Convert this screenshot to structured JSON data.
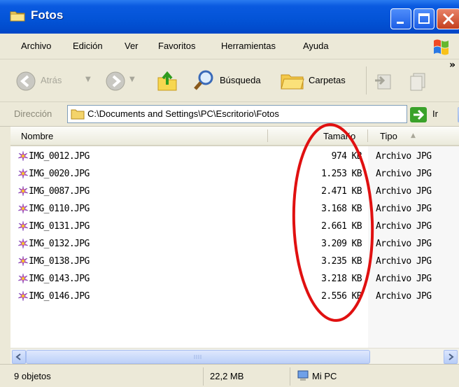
{
  "window": {
    "title": "Fotos"
  },
  "menu": {
    "items": [
      "Archivo",
      "Edición",
      "Ver",
      "Favoritos",
      "Herramientas",
      "Ayuda"
    ]
  },
  "toolbar": {
    "back_label": "Atrás",
    "search_label": "Búsqueda",
    "folders_label": "Carpetas",
    "overflow": "»"
  },
  "address": {
    "label": "Dirección",
    "path": "C:\\Documents and Settings\\PC\\Escritorio\\Fotos",
    "go_label": "Ir"
  },
  "columns": {
    "name": "Nombre",
    "size": "Tamaño",
    "type": "Tipo"
  },
  "files": [
    {
      "name": "IMG_0012.JPG",
      "size": "974 KB",
      "type": "Archivo JPG"
    },
    {
      "name": "IMG_0020.JPG",
      "size": "1.253 KB",
      "type": "Archivo JPG"
    },
    {
      "name": "IMG_0087.JPG",
      "size": "2.471 KB",
      "type": "Archivo JPG"
    },
    {
      "name": "IMG_0110.JPG",
      "size": "3.168 KB",
      "type": "Archivo JPG"
    },
    {
      "name": "IMG_0131.JPG",
      "size": "2.661 KB",
      "type": "Archivo JPG"
    },
    {
      "name": "IMG_0132.JPG",
      "size": "3.209 KB",
      "type": "Archivo JPG"
    },
    {
      "name": "IMG_0138.JPG",
      "size": "3.235 KB",
      "type": "Archivo JPG"
    },
    {
      "name": "IMG_0143.JPG",
      "size": "3.218 KB",
      "type": "Archivo JPG"
    },
    {
      "name": "IMG_0146.JPG",
      "size": "2.556 KB",
      "type": "Archivo JPG"
    }
  ],
  "status": {
    "objects": "9 objetos",
    "total_size": "22,2 MB",
    "location": "Mi PC"
  },
  "colors": {
    "titlebar": "#0353d6",
    "chrome": "#ece9d8",
    "annotation_ellipse": "#e01010"
  }
}
